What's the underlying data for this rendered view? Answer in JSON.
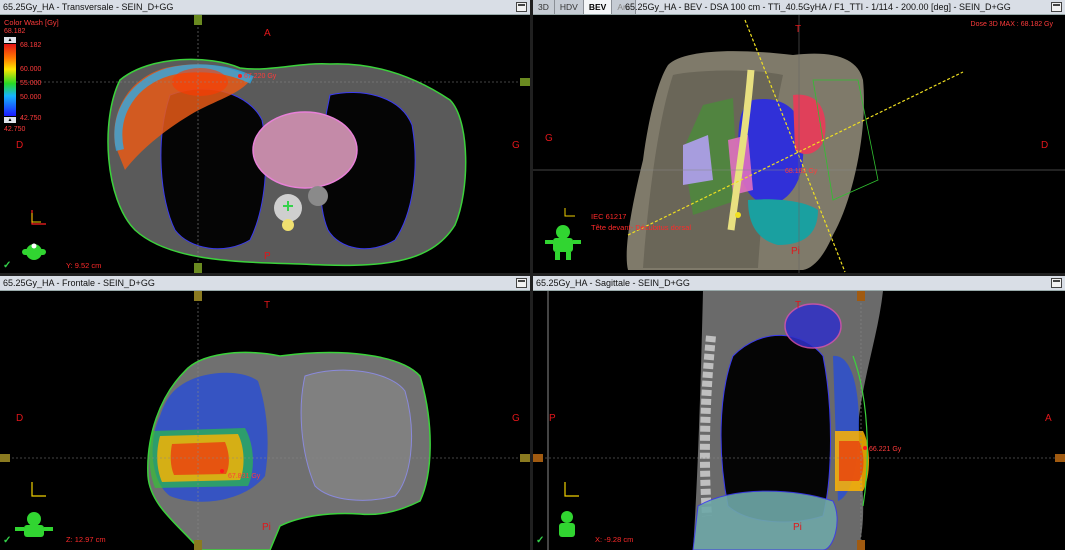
{
  "viewports": {
    "transverse": {
      "title": "65.25Gy_HA - Transversale - SEIN_D+GG",
      "orient": {
        "top": "A",
        "left": "D",
        "right": "G",
        "bottom": "P"
      },
      "coord": "Y: 9.52 cm",
      "dose_label": "67.220 Gy",
      "color_wash": {
        "title": "Color Wash [Gy]",
        "max": "68.182",
        "max_arrow": "68.182",
        "levels": [
          "60.000",
          "55.000",
          "50.000"
        ],
        "min_arrow": "42.750",
        "min": "42.750"
      }
    },
    "bev": {
      "tabs": [
        "3D",
        "HDV",
        "BEV",
        "Arc"
      ],
      "active_tab": "BEV",
      "title": "65.25Gy_HA - BEV - DSA 100 cm - TTi_40.5GyHA / F1_TTI - 1/114 - 200.00 [deg] - SEIN_D+GG",
      "dose_max": "Dose 3D MAX : 68.182 Gy",
      "orient": {
        "top": "T",
        "left": "G",
        "right": "D",
        "bottom": "Pi"
      },
      "dose_label": "68.182 Gy",
      "iec1": "IEC 61217",
      "iec2": "Tête devant- Décubitus dorsal"
    },
    "frontal": {
      "title": "65.25Gy_HA - Frontale - SEIN_D+GG",
      "orient": {
        "top": "T",
        "left": "D",
        "right": "G",
        "bottom": "Pi"
      },
      "coord": "Z: 12.97 cm",
      "dose_label": "67.831 Gy"
    },
    "sagittal": {
      "title": "65.25Gy_HA - Sagittale - SEIN_D+GG",
      "orient": {
        "top": "T",
        "left": "P",
        "right": "A",
        "bottom": "Pi"
      },
      "coord": "X: -9.28 cm",
      "dose_label": "66.221 Gy"
    }
  },
  "colors": {
    "accent": "#e0161a",
    "check": "#34d24a",
    "contour": "#3bd23b"
  }
}
